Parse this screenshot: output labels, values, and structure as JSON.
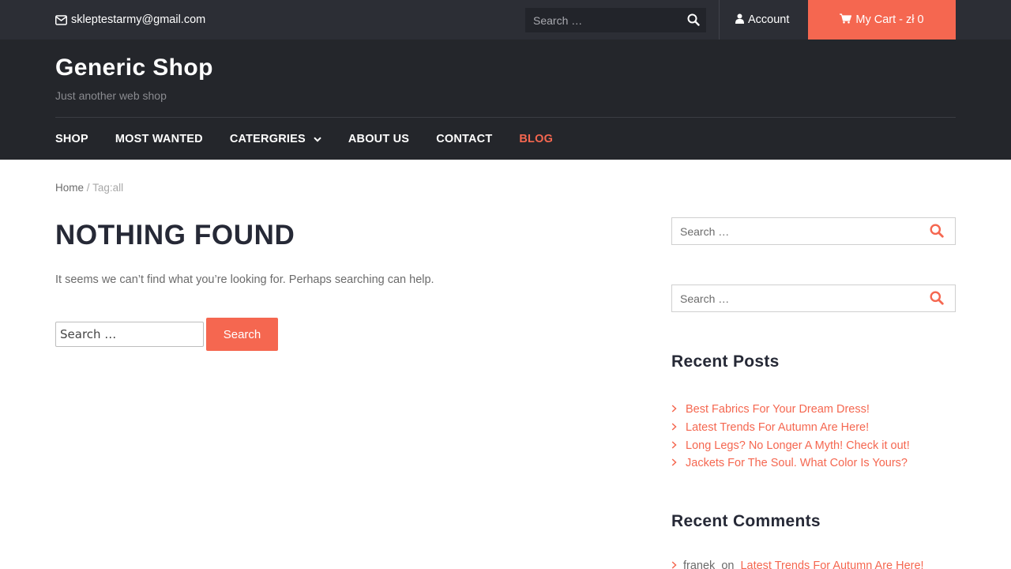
{
  "topbar": {
    "email": "skleptestarmy@gmail.com",
    "search_placeholder": "Search …",
    "account_label": "Account",
    "cart_label": "My Cart - zł 0"
  },
  "header": {
    "site_title": "Generic Shop",
    "tagline": "Just another web shop"
  },
  "nav": {
    "items": [
      {
        "label": "SHOP"
      },
      {
        "label": "MOST WANTED"
      },
      {
        "label": "CATERGRIES"
      },
      {
        "label": "ABOUT US"
      },
      {
        "label": "CONTACT"
      },
      {
        "label": "BLOG"
      }
    ]
  },
  "breadcrumb": {
    "home": "Home",
    "separator": "/",
    "current": "Tag:all"
  },
  "main": {
    "title": "NOTHING FOUND",
    "message": "It seems we can’t find what you’re looking for. Perhaps searching can help.",
    "search_placeholder": "Search …",
    "search_button": "Search"
  },
  "sidebar": {
    "search_placeholder": "Search …",
    "recent_posts_title": "Recent Posts",
    "recent_posts": [
      "Best Fabrics For Your Dream Dress!",
      "Latest Trends For Autumn Are Here!",
      "Long Legs? No Longer A Myth! Check it out!",
      "Jackets For The Soul. What Color Is Yours?"
    ],
    "recent_comments_title": "Recent Comments",
    "recent_comment": {
      "author": "franek",
      "on": "on",
      "post": "Latest Trends For Autumn Are Here!"
    }
  },
  "colors": {
    "accent": "#f56750",
    "topbar_bg": "#2c2e35",
    "header_bg": "#24262b",
    "heading": "#262936"
  }
}
